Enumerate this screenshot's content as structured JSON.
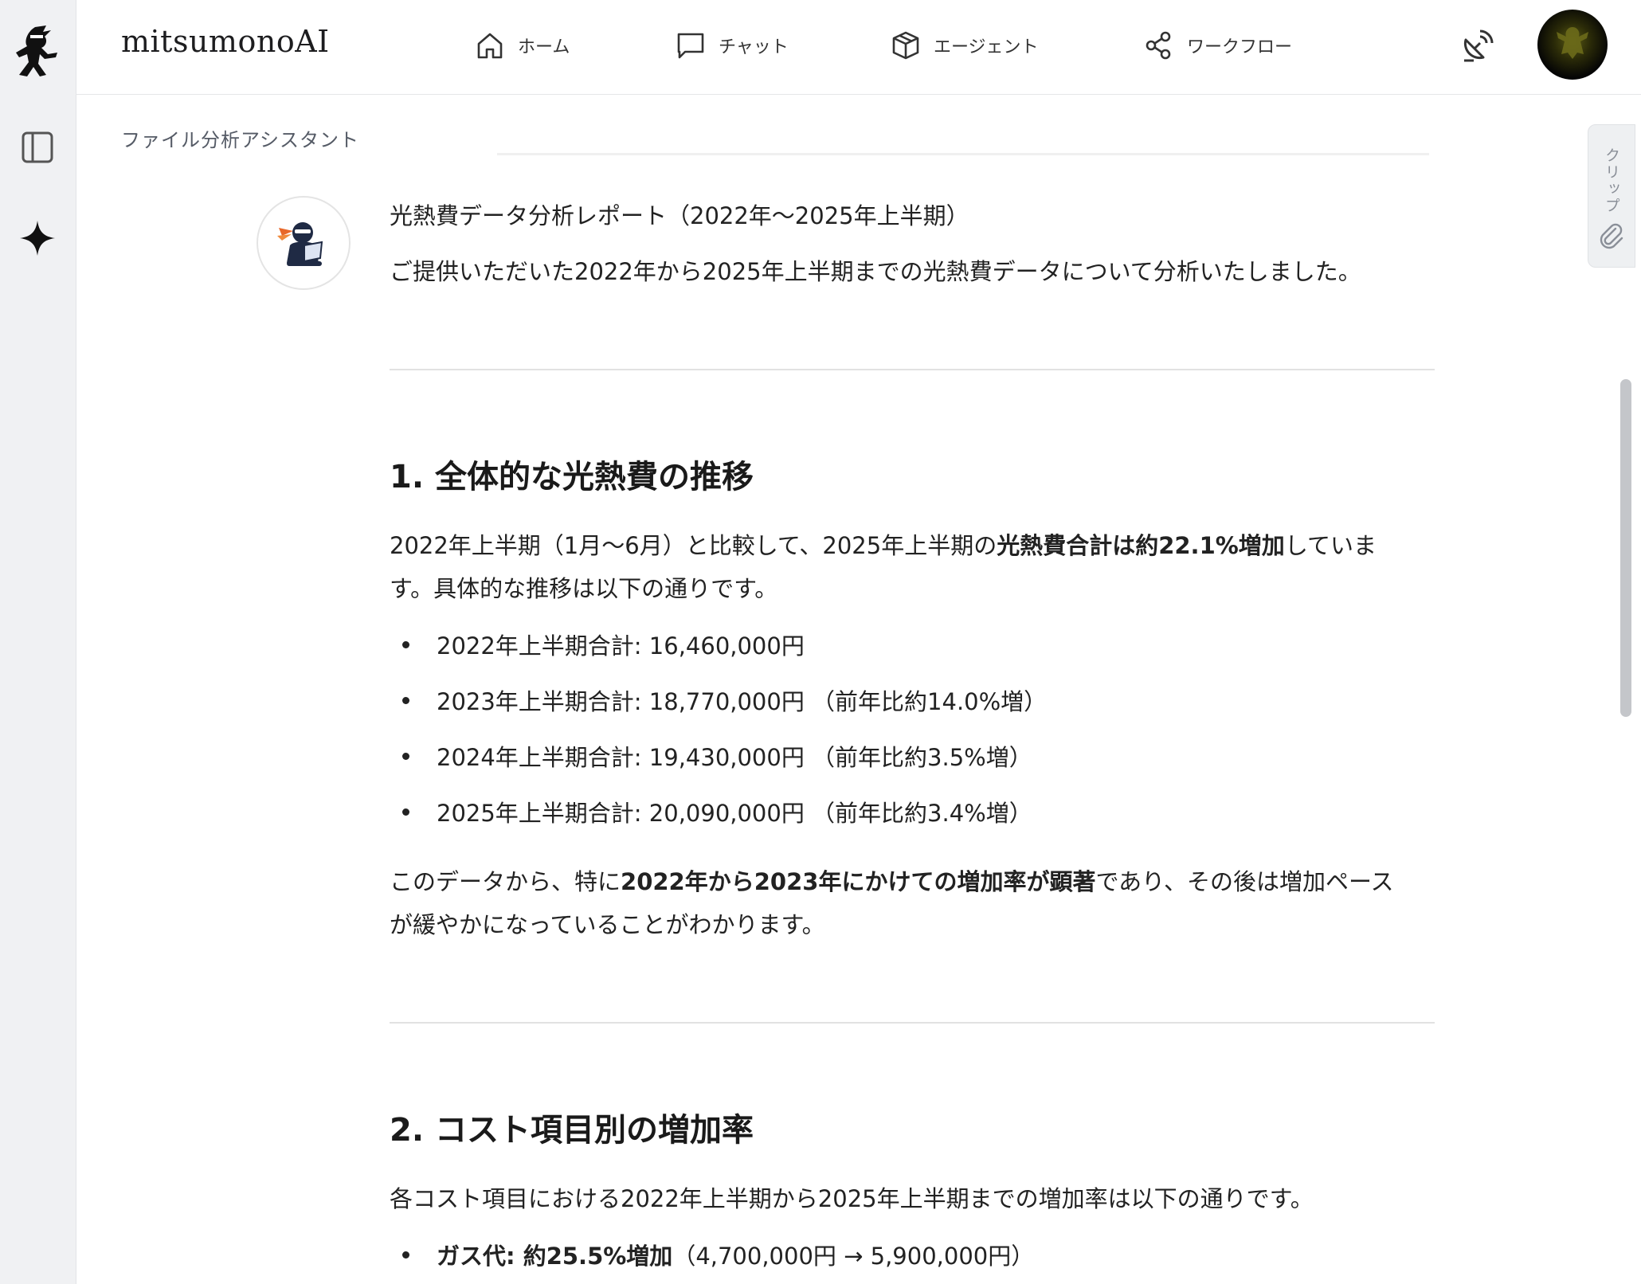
{
  "app": {
    "brand": "mitsumonoAI",
    "breadcrumb": "ファイル分析アシスタント"
  },
  "nav": {
    "home": "ホーム",
    "chat": "チャット",
    "agent": "エージェント",
    "workflow": "ワークフロー"
  },
  "clip": {
    "label": "クリップ"
  },
  "message": {
    "title": "光熱費データ分析レポート（2022年～2025年上半期）",
    "intro": "ご提供いただいた2022年から2025年上半期までの光熱費データについて分析いたしました。",
    "section1": {
      "heading": "1. 全体的な光熱費の推移",
      "p1_a": "2022年上半期（1月～6月）と比較して、2025年上半期の",
      "p1_b": "光熱費合計は約22.1%増加",
      "p1_c": "していま",
      "p1_d": "す。具体的な推移は以下の通りです。",
      "items": [
        "2022年上半期合計: 16,460,000円",
        "2023年上半期合計: 18,770,000円 （前年比約14.0%増）",
        "2024年上半期合計: 19,430,000円 （前年比約3.5%増）",
        "2025年上半期合計: 20,090,000円 （前年比約3.4%増）"
      ],
      "p2_a": "このデータから、特に",
      "p2_b": "2022年から2023年にかけての増加率が顕著",
      "p2_c": "であり、その後は増加ペース",
      "p2_d": "が緩やかになっていることがわかります。"
    },
    "section2": {
      "heading": "2. コスト項目別の増加率",
      "p1": "各コスト項目における2022年上半期から2025年上半期までの増加率は以下の通りです。",
      "item1_bold": "ガス代: 約25.5%増加",
      "item1_rest": "（4,700,000円 → 5,900,000円）"
    }
  },
  "colors": {
    "rail_bg": "#f0f1f3",
    "text": "#222222",
    "divider": "#e2e2e2"
  }
}
